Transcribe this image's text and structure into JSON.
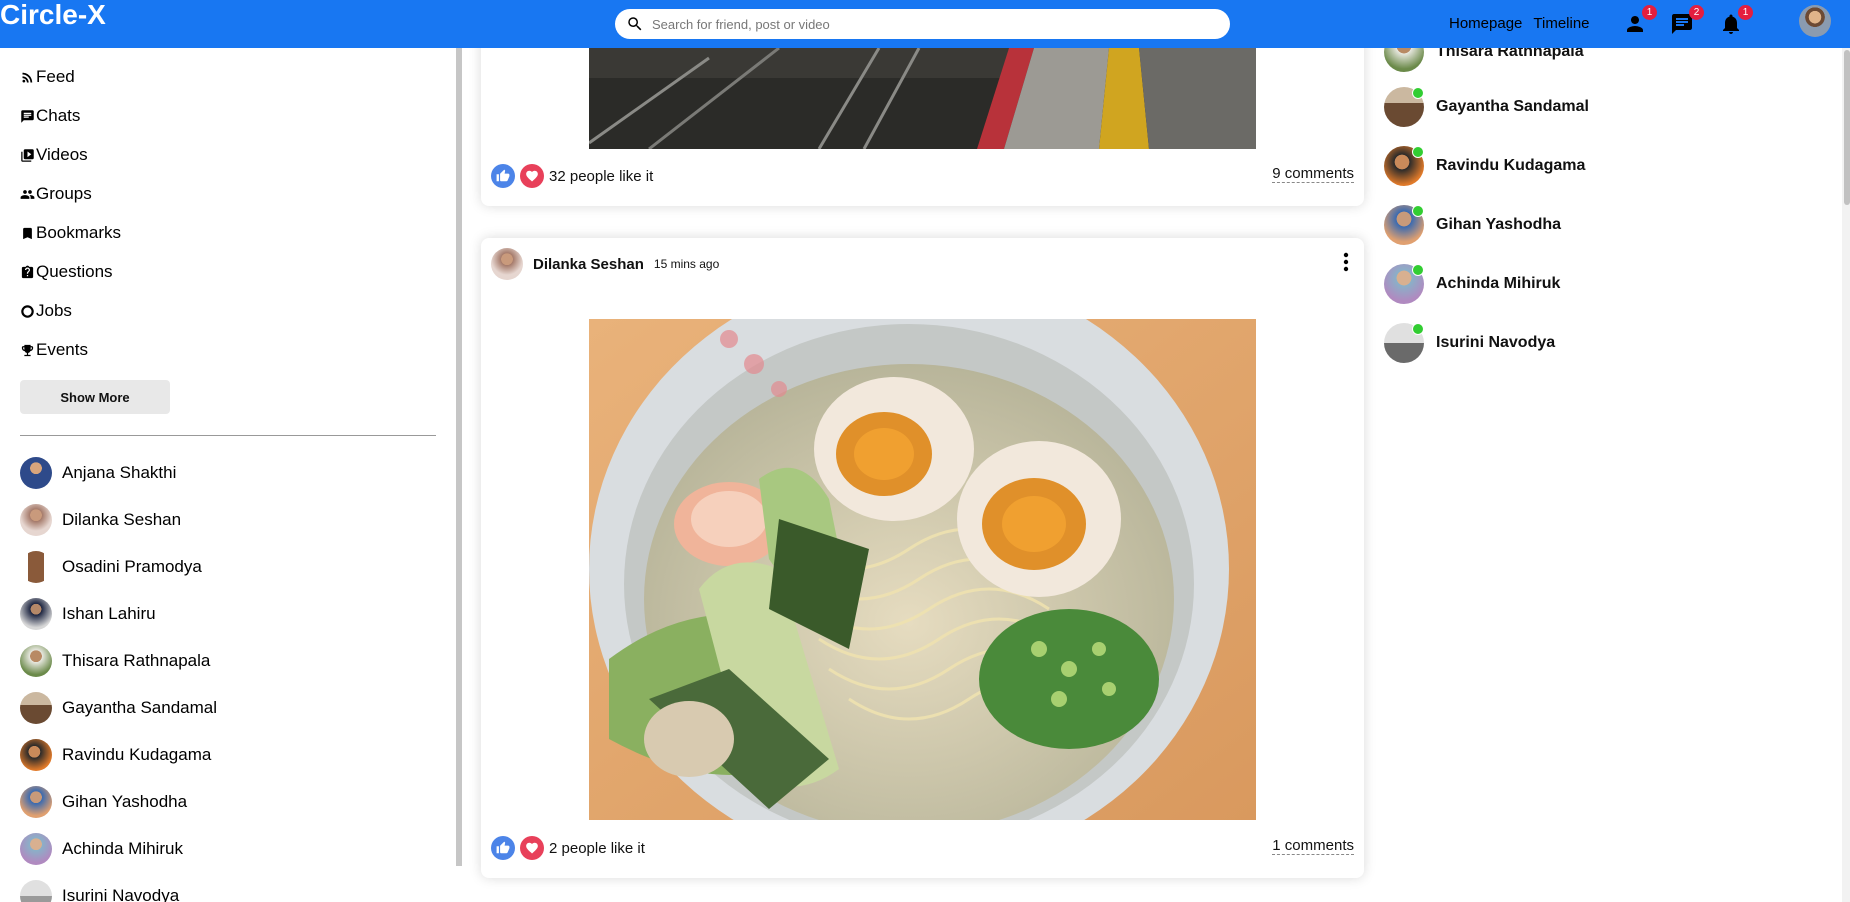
{
  "header": {
    "logo": "Circle-X",
    "search_placeholder": "Search for friend, post or video",
    "links": [
      "Homepage",
      "Timeline"
    ],
    "badges": {
      "friends": "1",
      "chats": "2",
      "notifications": "1"
    },
    "accent": "#1877f2"
  },
  "sidebar": {
    "menu": [
      {
        "label": "Feed",
        "icon": "rss-icon"
      },
      {
        "label": "Chats",
        "icon": "chat-icon"
      },
      {
        "label": "Videos",
        "icon": "video-library-icon"
      },
      {
        "label": "Groups",
        "icon": "groups-icon"
      },
      {
        "label": "Bookmarks",
        "icon": "bookmark-icon"
      },
      {
        "label": "Questions",
        "icon": "help-icon"
      },
      {
        "label": "Jobs",
        "icon": "work-icon"
      },
      {
        "label": "Events",
        "icon": "trophy-icon"
      }
    ],
    "show_more": "Show More",
    "friends": [
      "Anjana Shakthi",
      "Dilanka Seshan",
      "Osadini Pramodya",
      "Ishan Lahiru",
      "Thisara Rathnapala",
      "Gayantha Sandamal",
      "Ravindu Kudagama",
      "Gihan Yashodha",
      "Achinda Mihiruk",
      "Isurini Navodya"
    ]
  },
  "feed": {
    "post1": {
      "likes": "32 people like it",
      "comments": "9 comments"
    },
    "post2": {
      "author": "Dilanka Seshan",
      "time": "15 mins ago",
      "likes": "2 people like it",
      "comments": "1 comments"
    }
  },
  "online": {
    "friends": [
      "Thisara Rathnapala",
      "Gayantha Sandamal",
      "Ravindu Kudagama",
      "Gihan Yashodha",
      "Achinda Mihiruk",
      "Isurini Navodya"
    ]
  }
}
